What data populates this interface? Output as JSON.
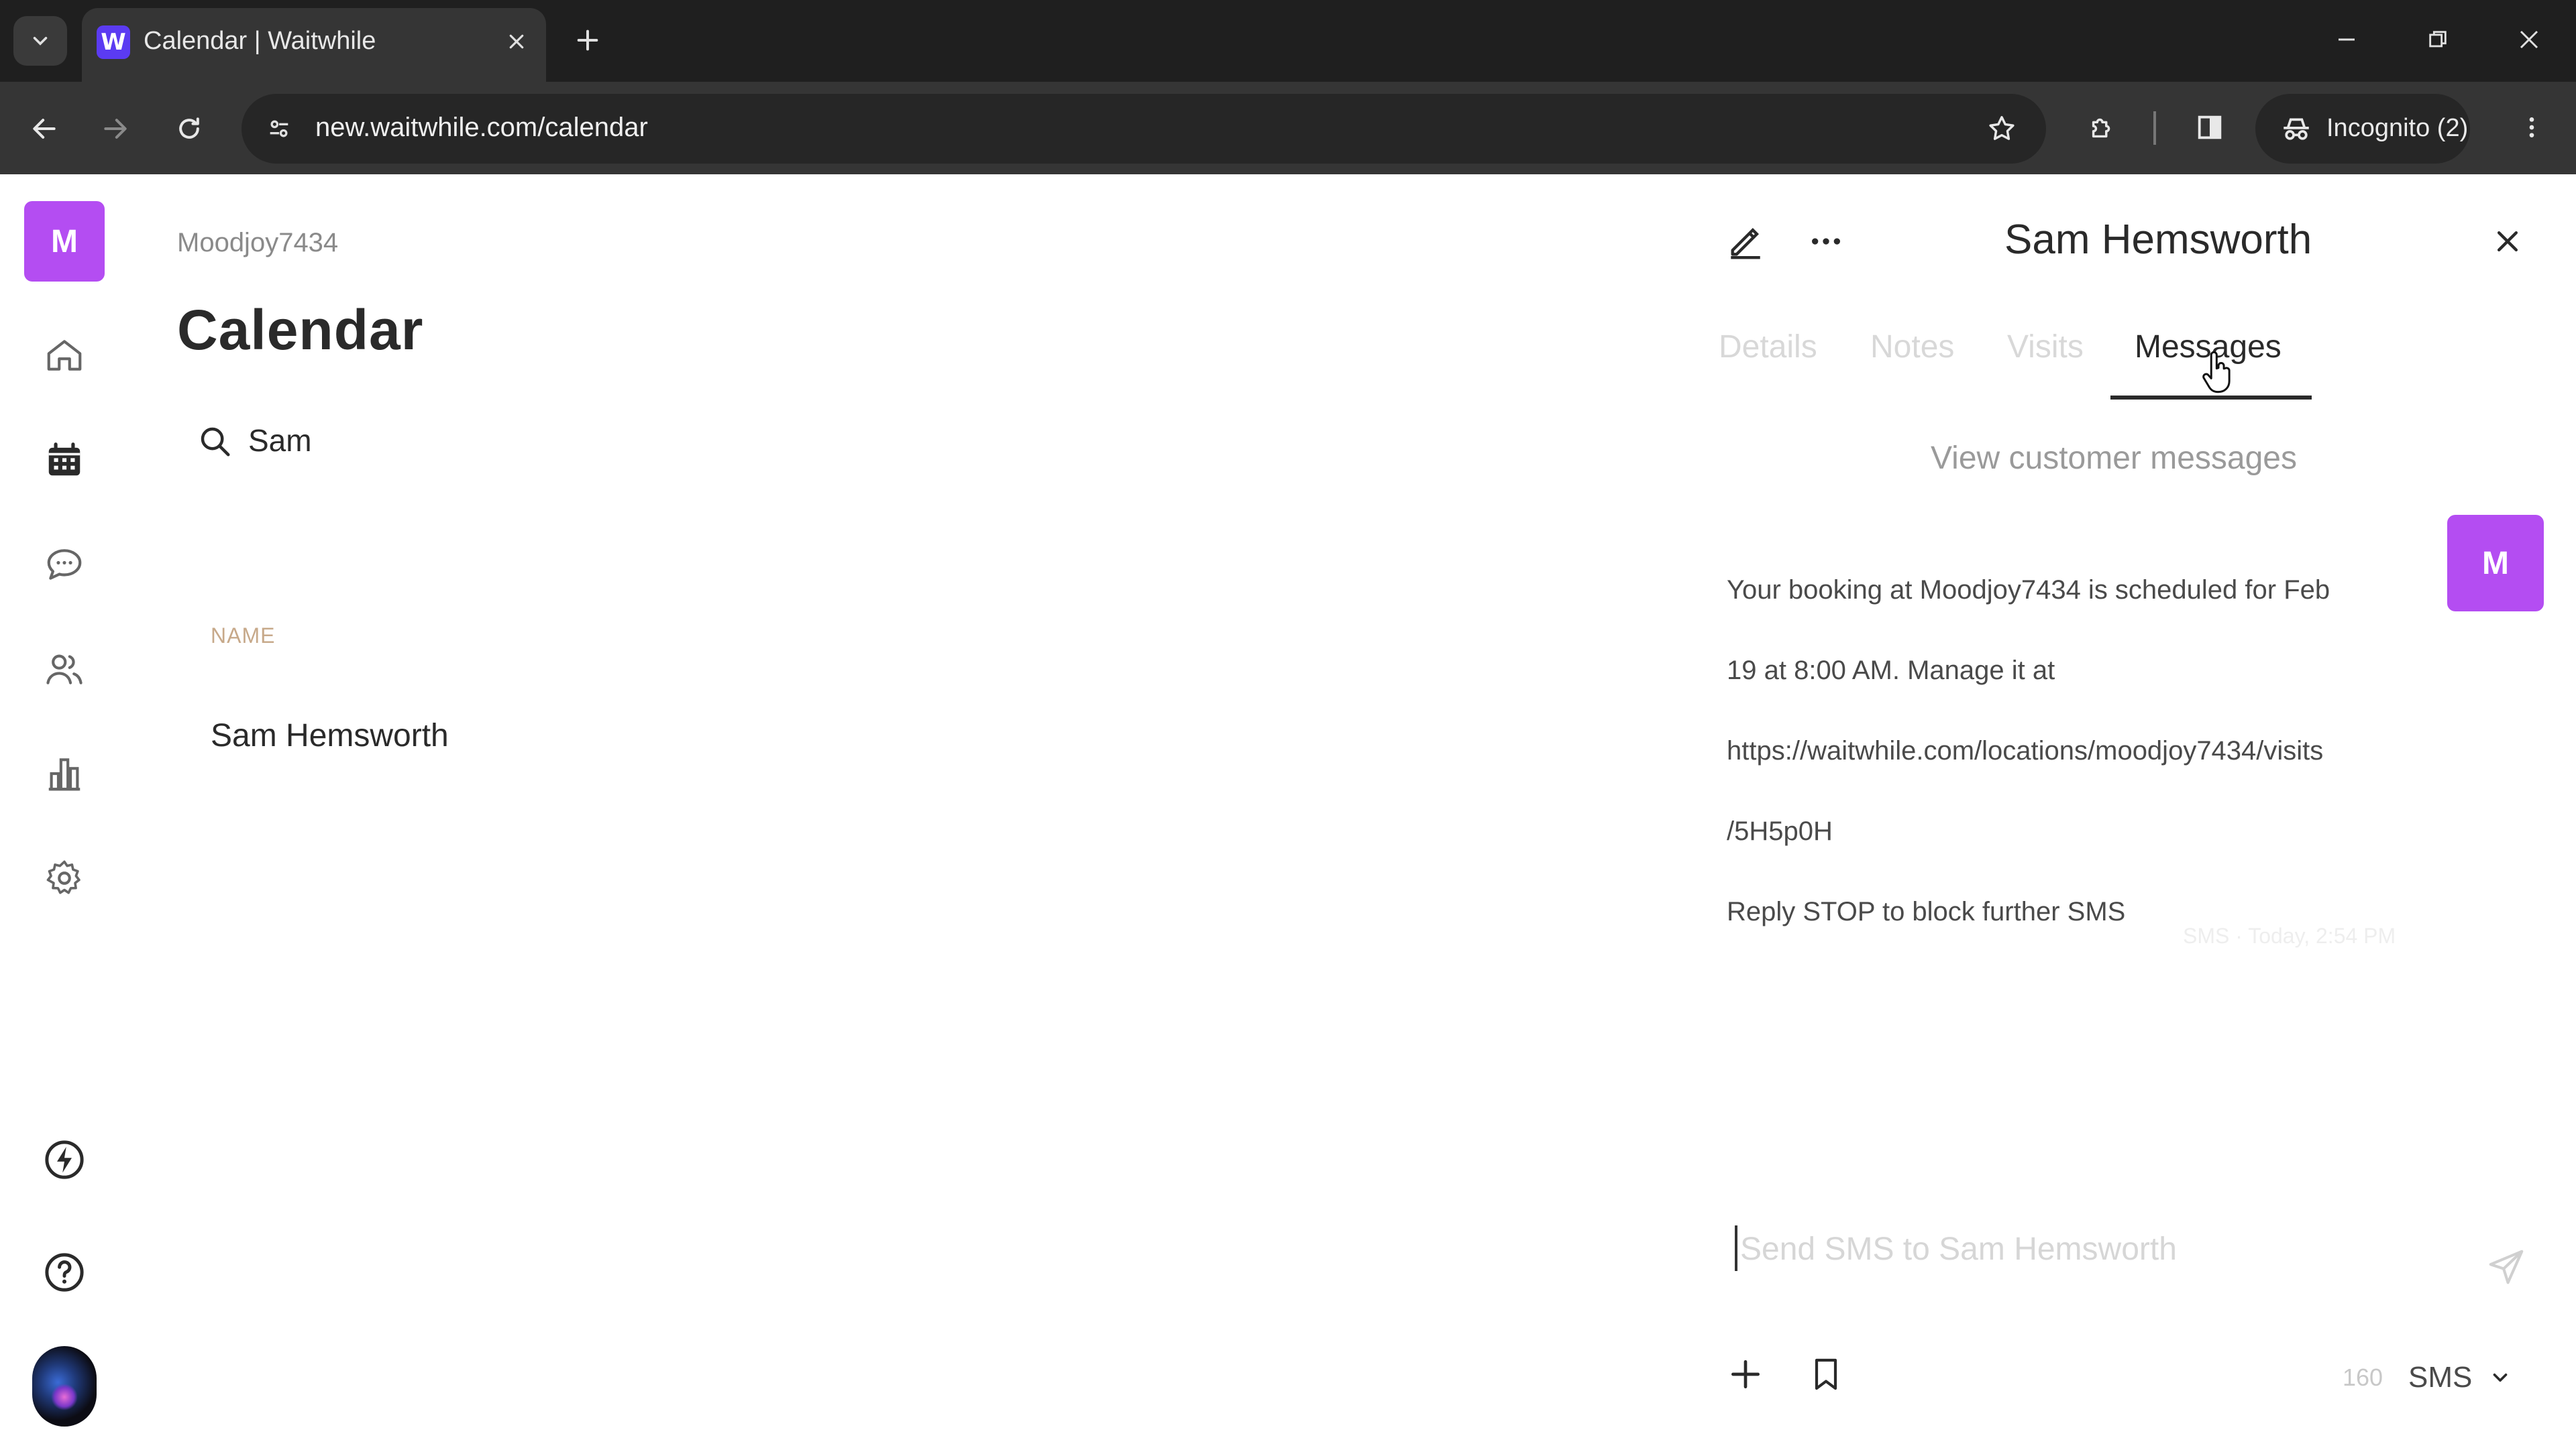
{
  "browser": {
    "tab_title": "Calendar | Waitwhile",
    "favicon_letter": "W",
    "url": "new.waitwhile.com/calendar",
    "incognito_label": "Incognito (2)"
  },
  "sidebar": {
    "workspace_initial": "M",
    "items": [
      {
        "name": "home-icon"
      },
      {
        "name": "calendar-icon"
      },
      {
        "name": "messages-icon"
      },
      {
        "name": "customers-icon"
      },
      {
        "name": "analytics-icon"
      },
      {
        "name": "settings-icon"
      },
      {
        "name": "lightning-icon"
      },
      {
        "name": "help-icon"
      }
    ]
  },
  "main": {
    "breadcrumb": "Moodjoy7434",
    "title": "Calendar",
    "search_value": "Sam",
    "column_header": "NAME",
    "rows": [
      "Sam Hemsworth"
    ]
  },
  "panel": {
    "title": "Sam Hemsworth",
    "tabs": [
      "Details",
      "Notes",
      "Visits",
      "Messages"
    ],
    "active_tab": "Messages",
    "view_link": "View customer messages",
    "message": {
      "lines": [
        "Your booking at Moodjoy7434 is scheduled for Feb",
        "19 at 8:00 AM. Manage it at",
        "https://waitwhile.com/locations/moodjoy7434/visits",
        "/5H5p0H",
        "Reply STOP to block further SMS"
      ],
      "avatar_initial": "M",
      "meta": "SMS · Today, 2:54 PM"
    },
    "compose": {
      "placeholder": "Send SMS to Sam Hemsworth",
      "char_count": "160",
      "channel": "SMS"
    }
  },
  "colors": {
    "accent_purple": "#b44df2",
    "chrome_dark": "#1f1f1f",
    "chrome_toolbar": "#353535",
    "text_dark": "#2a2a2a"
  }
}
